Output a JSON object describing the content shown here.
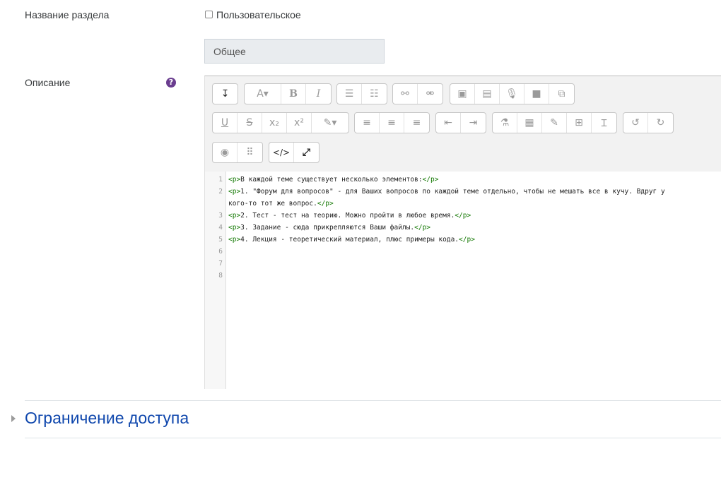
{
  "form": {
    "section_name_label": "Название раздела",
    "custom_checkbox_label": "Пользовательское",
    "section_name_value": "Общее",
    "description_label": "Описание",
    "help_symbol": "?"
  },
  "toolbar": {
    "buttons": [
      {
        "name": "toolbar-toggle-button",
        "glyph": "↧"
      },
      {
        "name": "font-family-button",
        "glyph": "A▾"
      },
      {
        "name": "bold-button",
        "glyph": "B"
      },
      {
        "name": "italic-button",
        "glyph": "I"
      },
      {
        "name": "bullet-list-button",
        "glyph": "☰"
      },
      {
        "name": "numbered-list-button",
        "glyph": "☷"
      },
      {
        "name": "link-button",
        "glyph": "⚯"
      },
      {
        "name": "unlink-button",
        "glyph": "⚮"
      },
      {
        "name": "image-button",
        "glyph": "▣"
      },
      {
        "name": "media-button",
        "glyph": "▤"
      },
      {
        "name": "record-audio-button",
        "glyph": "🎙"
      },
      {
        "name": "record-video-button",
        "glyph": "■"
      },
      {
        "name": "manage-files-button",
        "glyph": "⧉"
      },
      {
        "name": "underline-button",
        "glyph": "U"
      },
      {
        "name": "strikethrough-button",
        "glyph": "S"
      },
      {
        "name": "subscript-button",
        "glyph": "x₂"
      },
      {
        "name": "superscript-button",
        "glyph": "x²"
      },
      {
        "name": "text-color-button",
        "glyph": "✎▾"
      },
      {
        "name": "align-left-button",
        "glyph": "≡"
      },
      {
        "name": "align-center-button",
        "glyph": "≡"
      },
      {
        "name": "align-right-button",
        "glyph": "≡"
      },
      {
        "name": "outdent-button",
        "glyph": "⇤"
      },
      {
        "name": "indent-button",
        "glyph": "⇥"
      },
      {
        "name": "equation-button",
        "glyph": "⚗"
      },
      {
        "name": "calculator-button",
        "glyph": "▦"
      },
      {
        "name": "edit-button",
        "glyph": "✎"
      },
      {
        "name": "table-button",
        "glyph": "⊞"
      },
      {
        "name": "cursor-button",
        "glyph": "Ɪ"
      },
      {
        "name": "undo-button",
        "glyph": "↺"
      },
      {
        "name": "redo-button",
        "glyph": "↻"
      },
      {
        "name": "accessibility-checker-button",
        "glyph": "◉"
      },
      {
        "name": "screenreader-helper-button",
        "glyph": "⠿"
      },
      {
        "name": "html-mode-button",
        "glyph": "</>"
      },
      {
        "name": "fullscreen-button",
        "glyph": "⤢"
      }
    ]
  },
  "editor": {
    "lines": [
      {
        "num": "1",
        "open": "<p>",
        "text": "В каждой теме существует несколько элементов:",
        "close": "</p>"
      },
      {
        "num": "2",
        "open": "<p>",
        "text": "1. \"Форум для вопросов\" - для Ваших вопросов по каждой теме отдельно, чтобы не мешать все в кучу. Вдруг у",
        "close": ""
      },
      {
        "num": "",
        "open": "",
        "text": "кого-то тот же вопрос.",
        "close": "</p>"
      },
      {
        "num": "3",
        "open": "<p>",
        "text": "2. Тест - тест на теорию. Можно пройти в любое время.",
        "close": "</p>"
      },
      {
        "num": "4",
        "open": "<p>",
        "text": "3. Задание - сюда прикрепляются Ваши файлы.",
        "close": "</p>"
      },
      {
        "num": "5",
        "open": "<p>",
        "text": "4. Лекция - теоретический материал, плюс примеры кода.",
        "close": "</p>"
      },
      {
        "num": "6",
        "open": "",
        "text": "",
        "close": ""
      },
      {
        "num": "7",
        "open": "",
        "text": "",
        "close": ""
      },
      {
        "num": "8",
        "open": "",
        "text": "",
        "close": ""
      }
    ]
  },
  "restrict_section": {
    "title": "Ограничение доступа"
  },
  "colors": {
    "section_title": "#0f47ad",
    "help_icon": "#6a3d8f",
    "html_tag": "#117700"
  }
}
